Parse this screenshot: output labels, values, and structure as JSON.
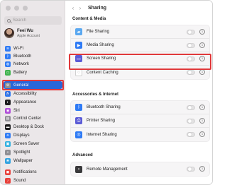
{
  "sidebar": {
    "search_placeholder": "Search",
    "account": {
      "name": "Feei Wu",
      "subtitle": "Apple Account"
    },
    "items": [
      {
        "label": "Wi-Fi",
        "icon": "wifi-icon",
        "color": "#2f7bf5",
        "glyph": "≋",
        "active": false
      },
      {
        "label": "Bluetooth",
        "icon": "bluetooth-icon",
        "color": "#2f7bf5",
        "glyph": "ᛒ",
        "active": false
      },
      {
        "label": "Network",
        "icon": "network-icon",
        "color": "#2f7bf5",
        "glyph": "◍",
        "active": false
      },
      {
        "label": "Battery",
        "icon": "battery-icon",
        "color": "#40b34f",
        "glyph": "▭",
        "active": false
      },
      {
        "label": "General",
        "icon": "gear-icon",
        "color": "#8e8e93",
        "glyph": "⚙",
        "active": true
      },
      {
        "label": "Accessibility",
        "icon": "accessibility-icon",
        "color": "#2f7bf5",
        "glyph": "♿",
        "active": false
      },
      {
        "label": "Appearance",
        "icon": "appearance-icon",
        "color": "#1c1c1e",
        "glyph": "◐",
        "active": false
      },
      {
        "label": "Siri",
        "icon": "siri-icon",
        "color": "#b04fd8",
        "glyph": "◉",
        "active": false
      },
      {
        "label": "Control Center",
        "icon": "control-center-icon",
        "color": "#8e8e93",
        "glyph": "▤",
        "active": false
      },
      {
        "label": "Desktop & Dock",
        "icon": "dock-icon",
        "color": "#1c1c1e",
        "glyph": "▬",
        "active": false
      },
      {
        "label": "Displays",
        "icon": "display-icon",
        "color": "#2f7bf5",
        "glyph": "☀",
        "active": false
      },
      {
        "label": "Screen Saver",
        "icon": "screen-saver-icon",
        "color": "#33b1e0",
        "glyph": "▣",
        "active": false
      },
      {
        "label": "Spotlight",
        "icon": "spotlight-icon",
        "color": "#8e8e93",
        "glyph": "⌕",
        "active": false
      },
      {
        "label": "Wallpaper",
        "icon": "wallpaper-icon",
        "color": "#33a3e0",
        "glyph": "❀",
        "active": false
      },
      {
        "label": "Notifications",
        "icon": "notifications-icon",
        "color": "#e8413b",
        "glyph": "◼",
        "active": false
      },
      {
        "label": "Sound",
        "icon": "sound-icon",
        "color": "#e8413b",
        "glyph": "♪",
        "active": false
      }
    ]
  },
  "header": {
    "title": "Sharing",
    "back": "‹",
    "forward": "›"
  },
  "sections": [
    {
      "title": "Content & Media",
      "rows": [
        {
          "label": "File Sharing",
          "icon": "folder-icon",
          "color": "#5aa8f0",
          "glyph": "▰",
          "enabled": false
        },
        {
          "label": "Media Sharing",
          "icon": "media-icon",
          "color": "#2f7bf5",
          "glyph": "▶",
          "enabled": false
        },
        {
          "label": "Screen Sharing",
          "icon": "screen-sharing-icon",
          "color": "#5b5bd6",
          "glyph": "▭",
          "enabled": false
        },
        {
          "label": "Content Caching",
          "icon": "content-caching-icon",
          "color": "#ffffff",
          "glyph": "◌",
          "enabled": false
        }
      ]
    },
    {
      "title": "Accessories & Internet",
      "rows": [
        {
          "label": "Bluetooth Sharing",
          "icon": "bluetooth-sharing-icon",
          "color": "#2f7bf5",
          "glyph": "ᛒ",
          "enabled": false
        },
        {
          "label": "Printer Sharing",
          "icon": "printer-icon",
          "color": "#5b5bd6",
          "glyph": "⎙",
          "enabled": false
        },
        {
          "label": "Internet Sharing",
          "icon": "internet-sharing-icon",
          "color": "#2f7bf5",
          "glyph": "◎",
          "enabled": false
        }
      ]
    },
    {
      "title": "Advanced",
      "rows": [
        {
          "label": "Remote Management",
          "icon": "remote-management-icon",
          "color": "#3a3a3c",
          "glyph": "▪",
          "enabled": false
        }
      ]
    }
  ],
  "colors": {
    "accent": "#2966d9",
    "highlight": "#e0383a"
  }
}
